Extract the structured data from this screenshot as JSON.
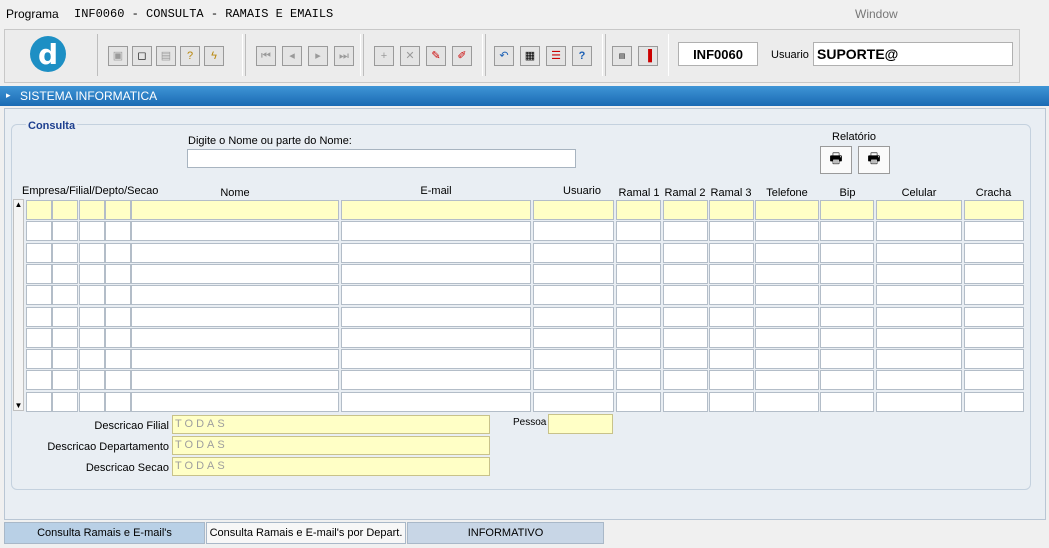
{
  "menubar": {
    "program": "Programa",
    "title": "INF0060 - CONSULTA - RAMAIS E EMAILS",
    "window": "Window"
  },
  "toolbar": {
    "logo": "d",
    "program_code": "INF0060",
    "usuario_label": "Usuario",
    "usuario_value": "SUPORTE@"
  },
  "section": {
    "title": "SISTEMA INFORMATICA"
  },
  "consulta": {
    "legend": "Consulta",
    "search_label": "Digite o Nome ou parte do Nome:",
    "search_value": "",
    "relatorio_label": "Relatório"
  },
  "grid": {
    "columns": [
      "Empresa/Filial/Depto/Secao",
      "Nome",
      "E-mail",
      "Usuario",
      "Ramal 1",
      "Ramal 2",
      "Ramal 3",
      "Telefone",
      "Bip",
      "Celular",
      "Cracha"
    ],
    "row_count": 10
  },
  "details": {
    "filial_label": "Descricao Filial",
    "filial_value": "TODAS",
    "depto_label": "Descricao Departamento",
    "depto_value": "TODAS",
    "secao_label": "Descricao Secao",
    "secao_value": "TODAS",
    "pessoa_label": "Pessoa",
    "pessoa_value": ""
  },
  "tabs": [
    "Consulta Ramais e E-mail's",
    "Consulta Ramais e E-mail's por Depart.",
    "INFORMATIVO"
  ]
}
